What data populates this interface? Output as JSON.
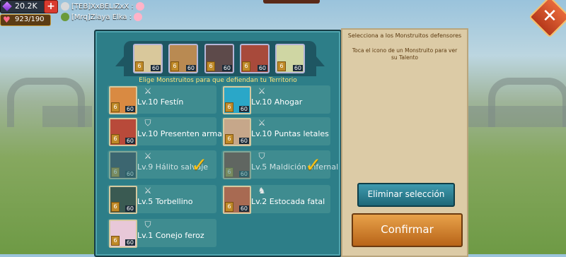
{
  "hud": {
    "gems": "20.2K",
    "plus": "+",
    "stamina": "923/190"
  },
  "chat": [
    {
      "author": "[TEB]XxBELIZxX :"
    },
    {
      "author": "[Mrq]Zlaya Elka :"
    }
  ],
  "close_label": "✕",
  "selected_team": [
    {
      "level": "60",
      "star": "6",
      "color": "#d9c89b"
    },
    {
      "level": "60",
      "star": "6",
      "color": "#b98a52"
    },
    {
      "level": "60",
      "star": "6",
      "color": "#5d4a4a"
    },
    {
      "level": "60",
      "star": "6",
      "color": "#a84a3b"
    },
    {
      "level": "60",
      "star": "6",
      "color": "#cfd6a3"
    }
  ],
  "hint": "Elige Monstruitos para que defiendan tu Territorio",
  "monsters": [
    {
      "name": "Lv.10 Festín",
      "level": "60",
      "star": "6",
      "type_icon": "bow-icon",
      "selected": false,
      "color": "#d98a42"
    },
    {
      "name": "Lv.10 Ahogar",
      "level": "60",
      "star": "6",
      "type_icon": "bow-icon",
      "selected": false,
      "color": "#2aa7c8"
    },
    {
      "name": "Lv.10 Presenten armas",
      "level": "60",
      "star": "6",
      "type_icon": "shield-icon",
      "selected": false,
      "color": "#b84a3a"
    },
    {
      "name": "Lv.10 Puntas letales",
      "level": "60",
      "star": "6",
      "type_icon": "bow-icon",
      "selected": false,
      "color": "#c6a78a"
    },
    {
      "name": "Lv.9 Hálito salvaje",
      "level": "60",
      "star": "6",
      "type_icon": "bow-icon",
      "selected": true,
      "color": "#3a3a4a"
    },
    {
      "name": "Lv.5 Maldición infernal",
      "level": "60",
      "star": "6",
      "type_icon": "shield-icon",
      "selected": true,
      "color": "#8a3a2a"
    },
    {
      "name": "Lv.5 Torbellino",
      "level": "60",
      "star": "6",
      "type_icon": "bow-icon",
      "selected": false,
      "color": "#3a5a52"
    },
    {
      "name": "Lv.2 Estocada fatal",
      "level": "60",
      "star": "6",
      "type_icon": "knight-icon",
      "selected": false,
      "color": "#a86a52"
    },
    {
      "name": "Lv.1 Conejo feroz",
      "level": "60",
      "star": "6",
      "type_icon": "shield-icon",
      "selected": false,
      "color": "#e8c8d8"
    }
  ],
  "right": {
    "title": "Selecciona a los Monstruitos defensores",
    "desc": "Toca el icono de un Monstruito para ver su Talento",
    "clear_label": "Eliminar selección",
    "confirm_label": "Confirmar"
  }
}
